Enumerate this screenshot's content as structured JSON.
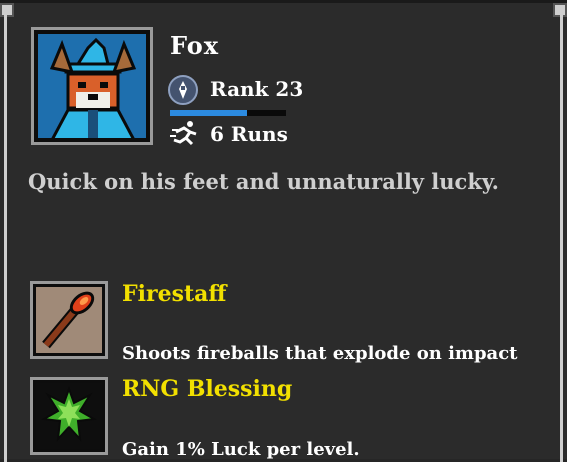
{
  "character": {
    "name": "Fox",
    "rank_label": "Rank 23",
    "rank_progress": 0.66,
    "runs_label": "6 Runs",
    "description": "Quick on his feet and unnaturally lucky."
  },
  "items": [
    {
      "title": "Firestaff",
      "description": "Shoots fireballs that explode on impact",
      "icon": "firestaff-icon"
    },
    {
      "title": "RNG Blessing",
      "description": "Gain 1% Luck per level.",
      "icon": "rng-blessing-icon"
    }
  ],
  "colors": {
    "panel_bg": "#2b2b2b",
    "portrait_bg": "#1e6fae",
    "xp_fill": "#2c8be0",
    "item_title": "#f2e000",
    "text_primary": "#ffffff",
    "text_secondary": "#cfcfcf"
  }
}
